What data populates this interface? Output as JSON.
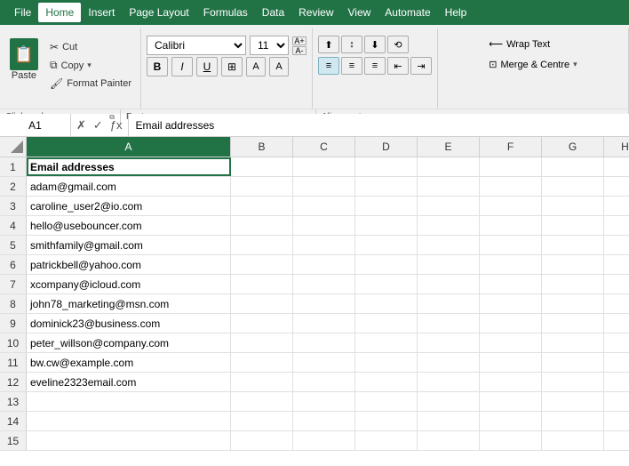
{
  "menu": {
    "items": [
      "File",
      "Home",
      "Insert",
      "Page Layout",
      "Formulas",
      "Data",
      "Review",
      "View",
      "Automate",
      "Help"
    ]
  },
  "ribbon": {
    "clipboard": {
      "label": "Clipboard",
      "paste": "Paste",
      "cut": "Cut",
      "copy": "Copy",
      "format_painter": "Format Painter"
    },
    "font": {
      "label": "Font",
      "font_name": "Calibri",
      "font_size": "11",
      "bold": "B",
      "italic": "I",
      "underline": "U",
      "increase_size": "▲",
      "decrease_size": "▼"
    },
    "alignment": {
      "label": "Alignment"
    },
    "wrap": {
      "label": "Alignment",
      "wrap_text": "Wrap Text",
      "merge_centre": "Merge & Centre"
    }
  },
  "formula_bar": {
    "cell_ref": "A1",
    "formula": "Email addresses"
  },
  "spreadsheet": {
    "columns": [
      "A",
      "B",
      "C",
      "D",
      "E",
      "F",
      "G",
      "H"
    ],
    "rows": [
      {
        "num": 1,
        "a": "Email addresses",
        "header": true
      },
      {
        "num": 2,
        "a": "adam@gmail.com"
      },
      {
        "num": 3,
        "a": "caroline_user2@io.com"
      },
      {
        "num": 4,
        "a": "hello@usebouncer.com"
      },
      {
        "num": 5,
        "a": "smithfamily@gmail.com"
      },
      {
        "num": 6,
        "a": "patrickbell@yahoo.com"
      },
      {
        "num": 7,
        "a": "xcompany@icloud.com"
      },
      {
        "num": 8,
        "a": "john78_marketing@msn.com"
      },
      {
        "num": 9,
        "a": "dominick23@business.com"
      },
      {
        "num": 10,
        "a": "peter_willson@company.com"
      },
      {
        "num": 11,
        "a": "bw.cw@example.com"
      },
      {
        "num": 12,
        "a": "eveline2323email.com"
      },
      {
        "num": 13,
        "a": ""
      },
      {
        "num": 14,
        "a": ""
      },
      {
        "num": 15,
        "a": ""
      }
    ]
  }
}
